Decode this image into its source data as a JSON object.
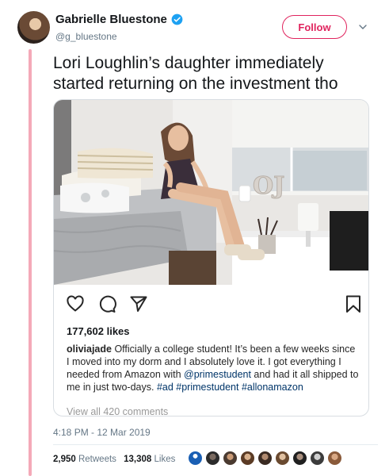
{
  "author": {
    "display_name": "Gabrielle Bluestone",
    "handle": "@g_bluestone",
    "verified": true
  },
  "follow_label": "Follow",
  "tweet_text": "Lori Loughlin’s daughter immediately started returning on the investment tho",
  "instagram_post": {
    "likes": "177,602 likes",
    "caption_user": "oliviajade",
    "caption_text_1": " Officially a college student! It’s been a few weeks since I moved into my dorm and I absolutely love it. I got everything I needed from Amazon with ",
    "caption_mention": "@primestudent",
    "caption_text_2": " and had it all shipped to me in just two-days. ",
    "caption_tags": "#ad #primestudent #allonamazon",
    "comments_link": "View all 420 comments",
    "photo_letters": "OJ"
  },
  "timestamp": "4:18 PM - 12 Mar 2019",
  "stats": {
    "retweets_count": "2,950",
    "retweets_label": "Retweets",
    "likes_count": "13,308",
    "likes_label": "Likes"
  },
  "colors": {
    "accent": "#e0245e",
    "verified": "#1da1f2",
    "thread_line": "#f4a9b8"
  }
}
